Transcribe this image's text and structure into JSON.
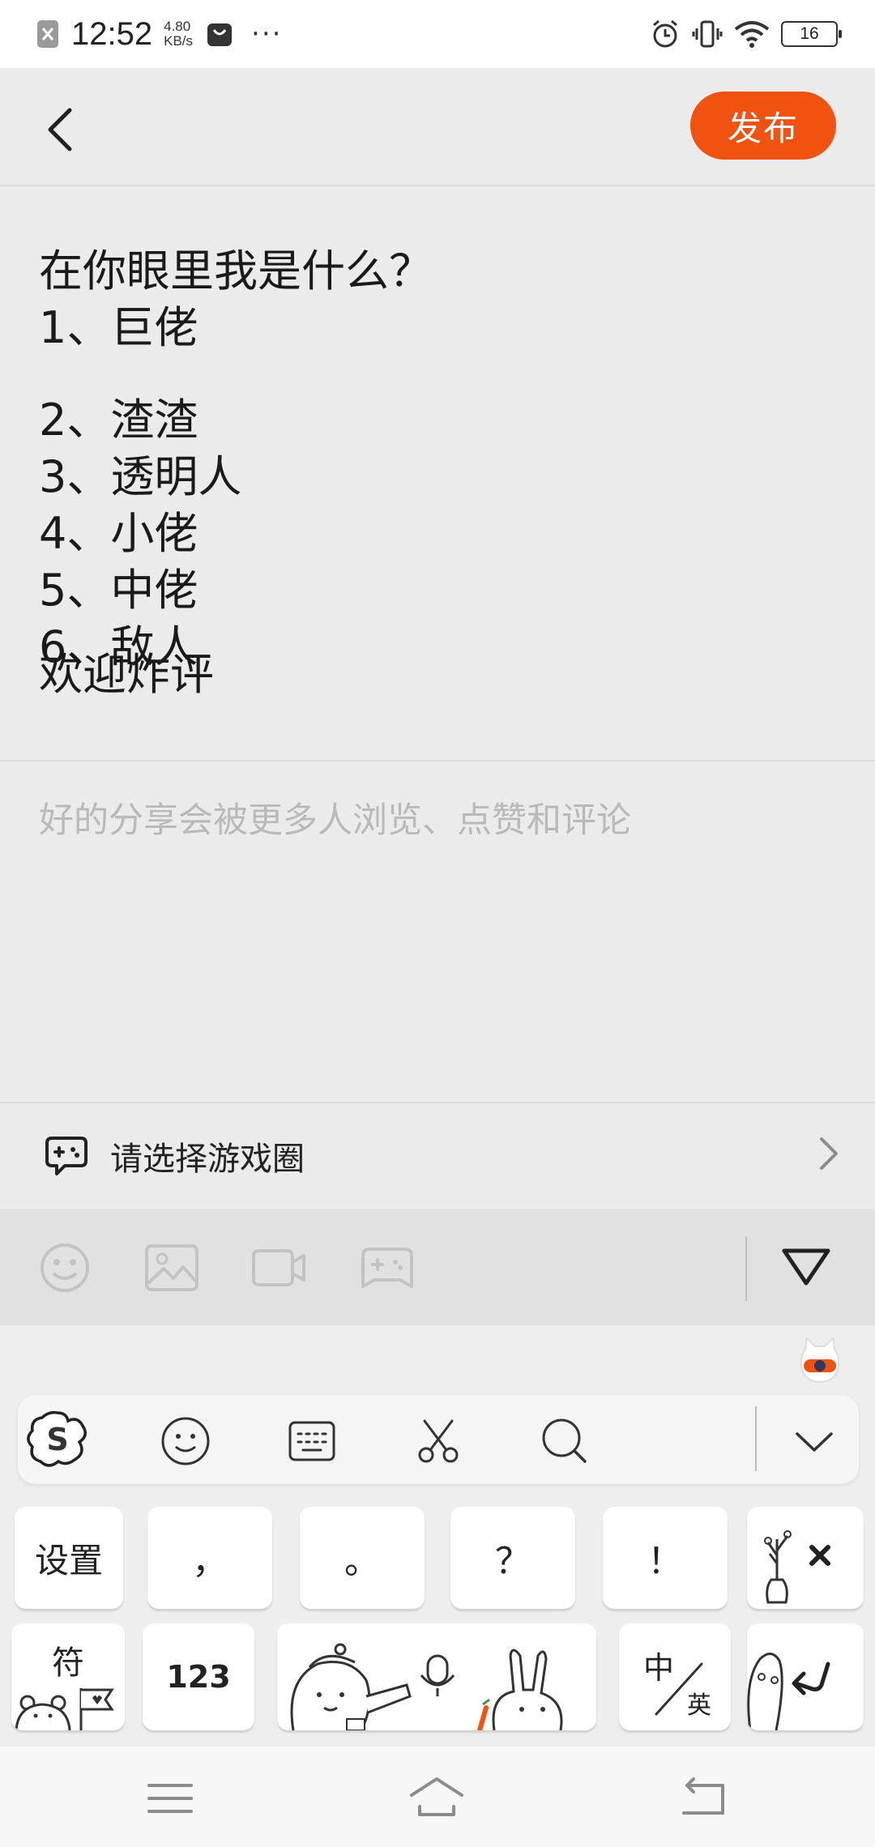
{
  "status_bar": {
    "time": "12:52",
    "net_speed_value": "4.80",
    "net_speed_unit": "KB/s",
    "more": "···",
    "battery_level": "16"
  },
  "header": {
    "publish_label": "发布"
  },
  "post": {
    "lines": [
      "在你眼里我是什么？",
      "1、巨佬",
      "2、渣渣",
      "3、透明人",
      "4、小佬",
      "5、中佬",
      "6、敌人",
      "欢迎炸评"
    ]
  },
  "description": {
    "placeholder": "好的分享会被更多人浏览、点赞和评论"
  },
  "game_circle": {
    "label": "请选择游戏圈"
  },
  "keyboard": {
    "keys_row1": [
      "设置",
      "，",
      "。",
      "？",
      "！"
    ],
    "symbols_label": "符",
    "numbers_label": "123",
    "lang_top": "中",
    "lang_bottom": "英"
  },
  "colors": {
    "accent": "#f15210",
    "background": "#ebebeb",
    "placeholder": "#b9b9b9"
  },
  "icons": {
    "back": "chevron-left-icon",
    "game_circle": "gamepad-chat-icon",
    "emoji": "smiley-icon",
    "image": "image-icon",
    "video": "video-icon",
    "game": "gamepad-icon",
    "collapse": "triangle-down-icon"
  }
}
